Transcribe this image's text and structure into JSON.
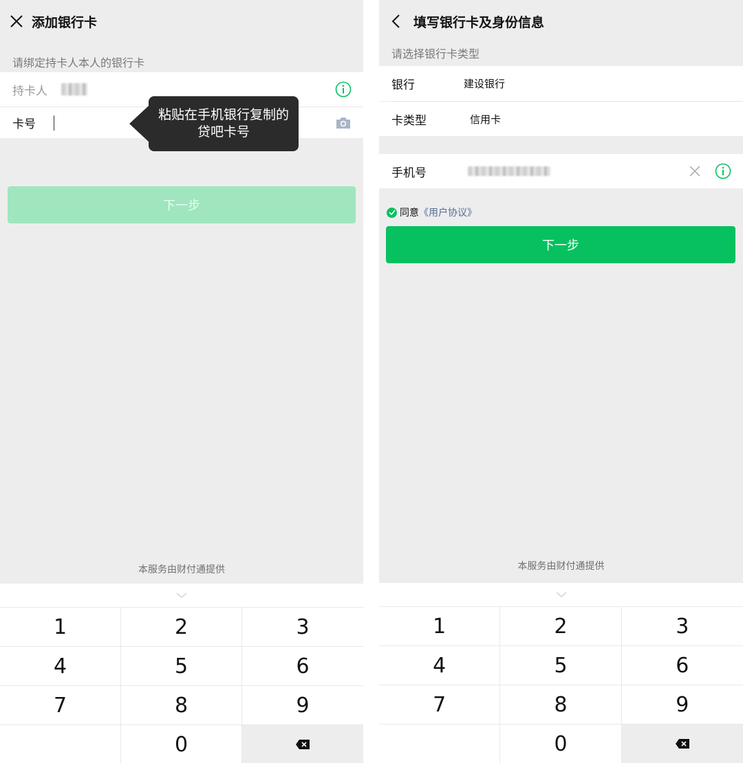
{
  "left": {
    "title": "添加银行卡",
    "hint": "请绑定持卡人本人的银行卡",
    "holder_label": "持卡人",
    "card_label": "卡号",
    "tooltip": "粘贴在手机银行复制的贷吧卡号",
    "next_button": "下一步",
    "footer": "本服务由财付通提供",
    "icons": {
      "close": "close-icon",
      "info": "info-icon",
      "camera": "camera-icon"
    }
  },
  "right": {
    "title": "填写银行卡及身份信息",
    "hint": "请选择银行卡类型",
    "bank_label": "银行",
    "bank_value": "建设银行",
    "card_type_label": "卡类型",
    "card_type_value": "信用卡",
    "phone_label": "手机号",
    "agree_text": "同意",
    "agreement_link": "《用户协议》",
    "next_button": "下一步",
    "footer": "本服务由财付通提供",
    "icons": {
      "back": "back-icon",
      "clear": "clear-icon",
      "info": "info-icon",
      "check": "check-icon"
    }
  },
  "keyboard": {
    "keys": [
      "1",
      "2",
      "3",
      "4",
      "5",
      "6",
      "7",
      "8",
      "9",
      "",
      "0",
      "⌫"
    ]
  },
  "colors": {
    "accent": "#07c160",
    "accent_disabled": "#9fe6bf",
    "link": "#576b95",
    "background": "#ededed"
  }
}
